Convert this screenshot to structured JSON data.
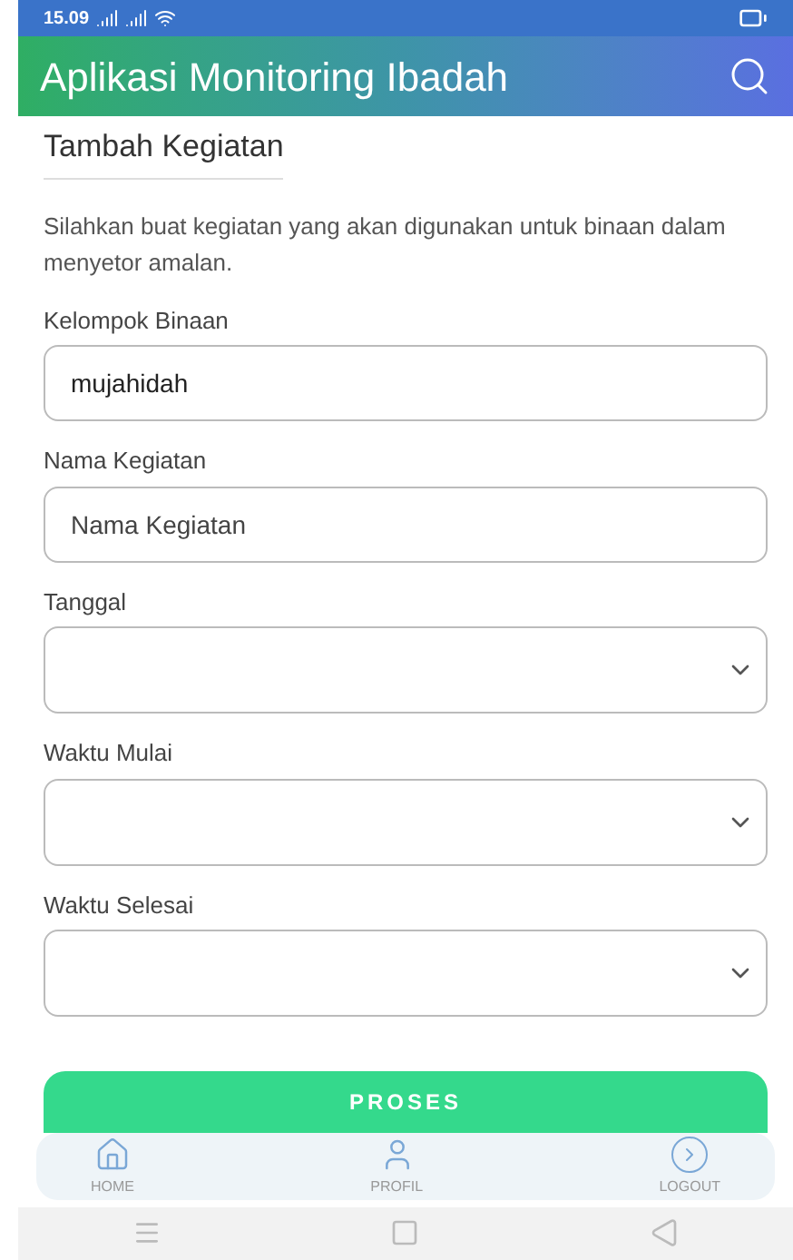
{
  "status_bar": {
    "time": "15.09"
  },
  "app_bar": {
    "title": "Aplikasi Monitoring Ibadah"
  },
  "form": {
    "title": "Tambah Kegiatan",
    "description": "Silahkan buat kegiatan yang akan digunakan untuk binaan dalam menyetor amalan.",
    "fields": [
      {
        "kind": "text",
        "label": "Kelompok Binaan",
        "value": "mujahidah"
      },
      {
        "kind": "text",
        "label": "Nama Kegiatan",
        "placeholder": "Nama Kegiatan"
      },
      {
        "kind": "select",
        "label": "Tanggal"
      },
      {
        "kind": "select",
        "label": "Waktu Mulai"
      },
      {
        "kind": "select",
        "label": "Waktu Selesai"
      }
    ],
    "submit": "PROSES"
  },
  "bottom_nav": [
    {
      "kind": "home",
      "label": "HOME"
    },
    {
      "kind": "profile",
      "label": "PROFIL"
    },
    {
      "kind": "logout",
      "label": "LOGOUT"
    }
  ]
}
